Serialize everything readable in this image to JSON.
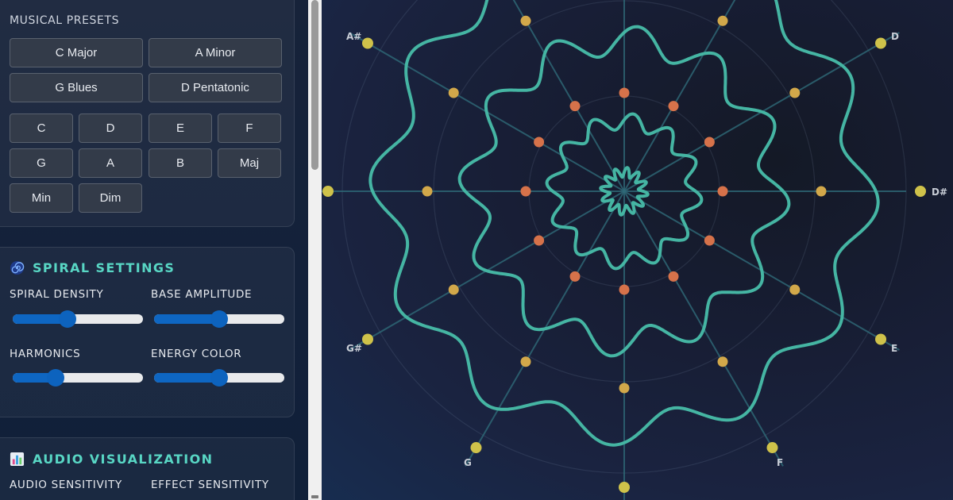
{
  "presets": {
    "heading": "MUSICAL PRESETS",
    "scales": [
      "C Major",
      "A Minor",
      "G Blues",
      "D Pentatonic"
    ],
    "notes": [
      "C",
      "D",
      "E",
      "F",
      "G",
      "A",
      "B",
      "Maj",
      "Min",
      "Dim"
    ]
  },
  "spiral_settings": {
    "title": "SPIRAL SETTINGS",
    "icon": "spiral-icon",
    "sliders": [
      {
        "label": "SPIRAL DENSITY",
        "value": 0.42
      },
      {
        "label": "BASE AMPLITUDE",
        "value": 0.5
      },
      {
        "label": "HARMONICS",
        "value": 0.33
      },
      {
        "label": "ENERGY COLOR",
        "value": 0.5
      }
    ]
  },
  "audio_visualization": {
    "title": "AUDIO VISUALIZATION",
    "icon": "bar-chart-icon",
    "sliders": [
      {
        "label": "AUDIO SENSITIVITY"
      },
      {
        "label": "EFFECT SENSITIVITY"
      }
    ]
  },
  "visualization": {
    "note_labels": [
      "D",
      "D#",
      "E",
      "F",
      "G",
      "G#",
      "A#"
    ],
    "colors": {
      "wave": "#45b5a3",
      "outer_dots": "#cfc24a",
      "mid_dots": "#d2a84a",
      "inner_dots": "#d6724a",
      "spokes": "#2f6a78",
      "slider_accent": "#0e66c2",
      "title_accent": "#58d6c4"
    }
  }
}
